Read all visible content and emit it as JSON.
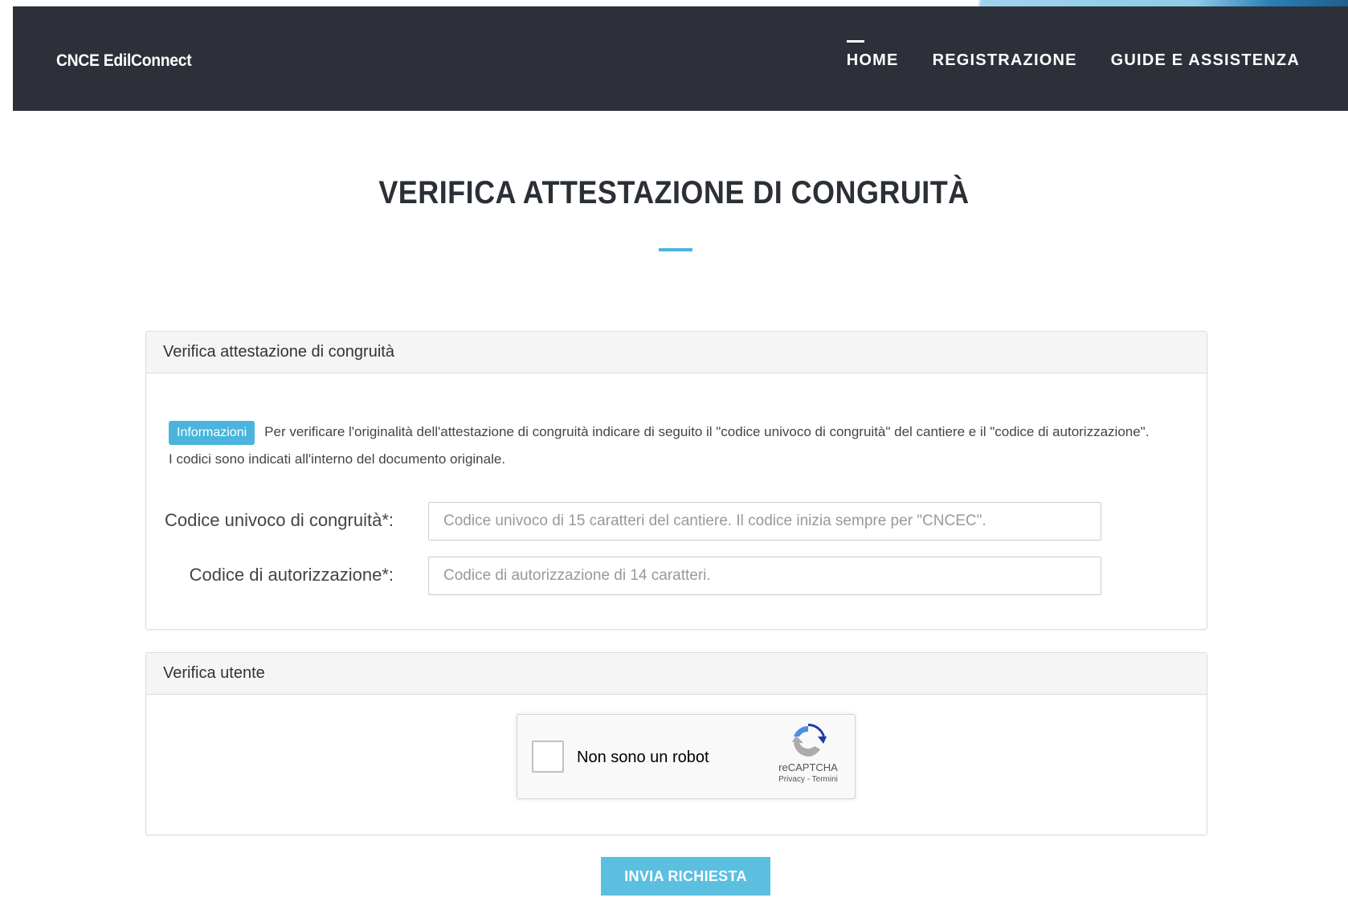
{
  "header": {
    "brand": "CNCE EdilConnect",
    "nav": [
      {
        "label": "HOME",
        "active": true
      },
      {
        "label": "REGISTRAZIONE",
        "active": false
      },
      {
        "label": "GUIDE E ASSISTENZA",
        "active": false
      }
    ]
  },
  "page": {
    "title": "VERIFICA ATTESTAZIONE DI CONGRUITÀ"
  },
  "panel_verifica": {
    "heading": "Verifica attestazione di congruità",
    "info_badge": "Informazioni",
    "info_text": "Per verificare l'originalità dell'attestazione di congruità indicare di seguito il \"codice univoco di congruità\" del cantiere e il \"codice di autorizzazione\".",
    "info_text_2": "I codici sono indicati all'interno del documento originale.",
    "field_codice_univoco": {
      "label": "Codice univoco di congruità*:",
      "placeholder": "Codice univoco di 15 caratteri del cantiere. Il codice inizia sempre per \"CNCEC\".",
      "value": ""
    },
    "field_codice_autorizzazione": {
      "label": "Codice di autorizzazione*:",
      "placeholder": "Codice di autorizzazione di 14 caratteri.",
      "value": ""
    }
  },
  "panel_utente": {
    "heading": "Verifica utente",
    "recaptcha": {
      "label": "Non sono un robot",
      "brand": "reCAPTCHA",
      "links": "Privacy - Termini",
      "checked": false
    }
  },
  "submit_label": "INVIA RICHIESTA",
  "colors": {
    "navbar": "#2d3038",
    "accent": "#4ab4dc",
    "button": "#5bbfe0"
  }
}
